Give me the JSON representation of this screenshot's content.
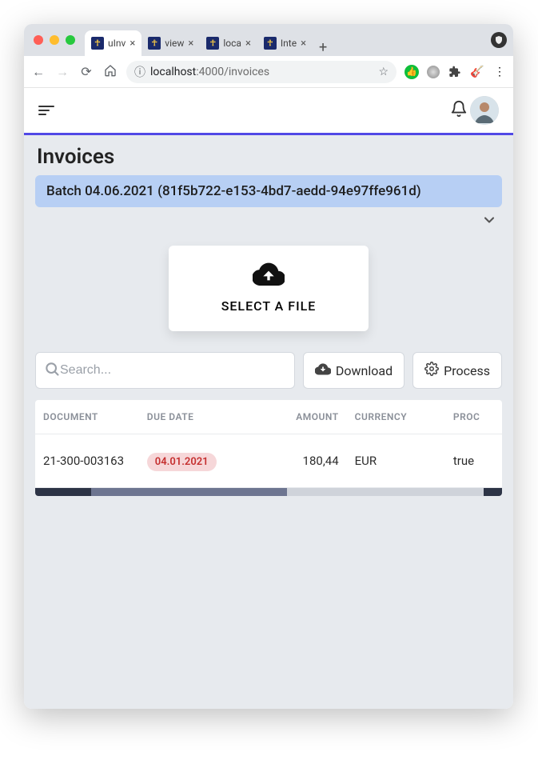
{
  "browser": {
    "tabs": [
      {
        "title": "uInv"
      },
      {
        "title": "view"
      },
      {
        "title": "loca"
      },
      {
        "title": "Inte"
      }
    ],
    "url_host": "localhost",
    "url_port": ":4000",
    "url_path": "/invoices"
  },
  "page": {
    "title": "Invoices",
    "batch_label": "Batch 04.06.2021 (81f5b722-e153-4bd7-aedd-94e97ffe961d)"
  },
  "upload": {
    "label": "SELECT A FILE"
  },
  "search": {
    "placeholder": "Search..."
  },
  "buttons": {
    "download": "Download",
    "process": "Process"
  },
  "table": {
    "columns": {
      "document": "DOCUMENT",
      "due": "DUE DATE",
      "amount": "AMOUNT",
      "currency": "CURRENCY",
      "processed": "PROC"
    },
    "rows": [
      {
        "document": "21-300-003163",
        "due": "04.01.2021",
        "amount": "180,44",
        "currency": "EUR",
        "processed": "true"
      }
    ]
  }
}
